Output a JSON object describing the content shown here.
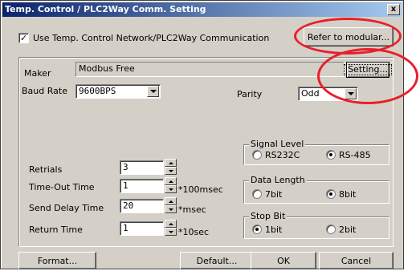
{
  "window": {
    "title": "Temp. Control / PLC2Way Comm. Setting",
    "close_glyph": "x"
  },
  "top": {
    "use_network_checked": true,
    "use_network_label": "Use Temp. Control Network/PLC2Way Communication",
    "refer_button": "Refer to modular..."
  },
  "maker": {
    "label": "Maker",
    "value": "Modbus Free",
    "setting_button": "Setting..."
  },
  "baud_rate": {
    "label": "Baud Rate",
    "value": "9600BPS"
  },
  "parity": {
    "label": "Parity",
    "value": "Odd"
  },
  "retrials": {
    "label": "Retrials",
    "value": "3"
  },
  "timeout": {
    "label": "Time-Out Time",
    "value": "1",
    "unit": "*100msec"
  },
  "send_delay": {
    "label": "Send Delay Time",
    "value": "20",
    "unit": "*msec"
  },
  "return_time": {
    "label": "Return Time",
    "value": "1",
    "unit": "*10sec"
  },
  "signal_level": {
    "title": "Signal Level",
    "options": [
      "RS232C",
      "RS-485"
    ],
    "selected": "RS-485"
  },
  "data_length": {
    "title": "Data Length",
    "options": [
      "7bit",
      "8bit"
    ],
    "selected": "8bit"
  },
  "stop_bit": {
    "title": "Stop Bit",
    "options": [
      "1bit",
      "2bit"
    ],
    "selected": "1bit"
  },
  "buttons": {
    "format": "Format...",
    "default": "Default...",
    "ok": "OK",
    "cancel": "Cancel"
  },
  "annotation_color": "#e8202a"
}
